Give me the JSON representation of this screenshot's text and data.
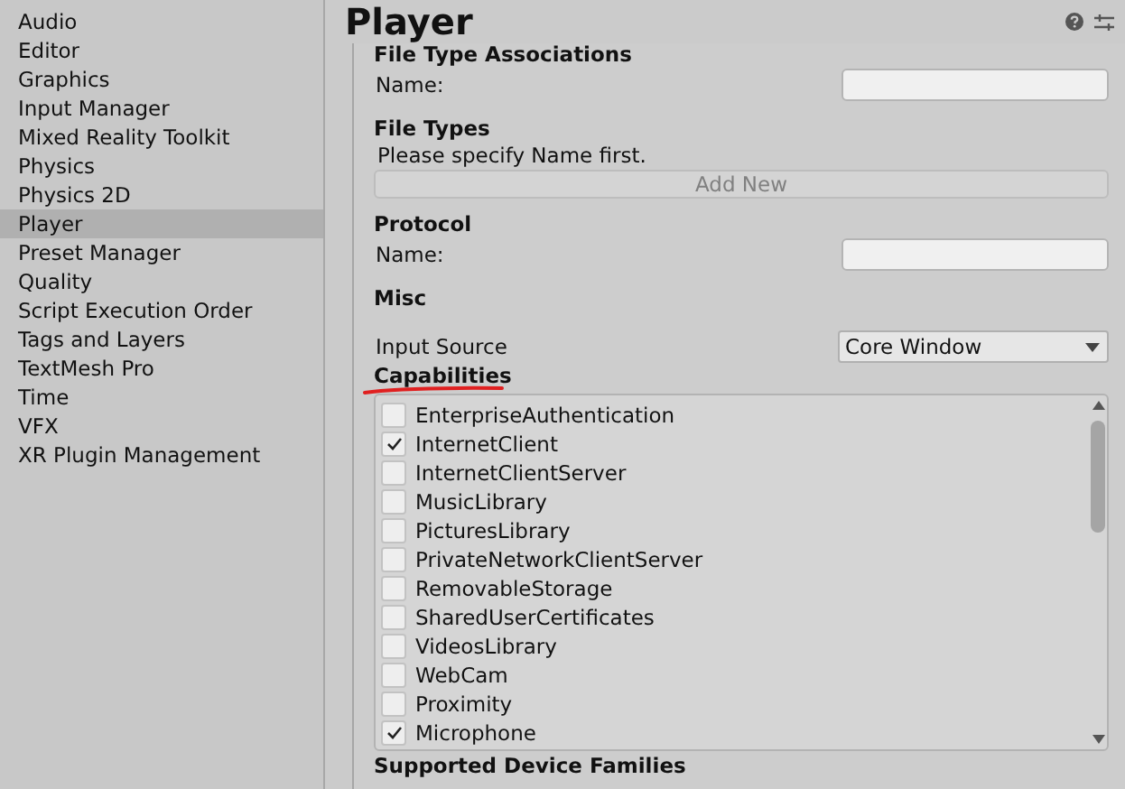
{
  "sidebar": {
    "items": [
      {
        "label": "Audio",
        "selected": false
      },
      {
        "label": "Editor",
        "selected": false
      },
      {
        "label": "Graphics",
        "selected": false
      },
      {
        "label": "Input Manager",
        "selected": false
      },
      {
        "label": "Mixed Reality Toolkit",
        "selected": false
      },
      {
        "label": "Physics",
        "selected": false
      },
      {
        "label": "Physics 2D",
        "selected": false
      },
      {
        "label": "Player",
        "selected": true
      },
      {
        "label": "Preset Manager",
        "selected": false
      },
      {
        "label": "Quality",
        "selected": false
      },
      {
        "label": "Script Execution Order",
        "selected": false
      },
      {
        "label": "Tags and Layers",
        "selected": false
      },
      {
        "label": "TextMesh Pro",
        "selected": false
      },
      {
        "label": "Time",
        "selected": false
      },
      {
        "label": "VFX",
        "selected": false
      },
      {
        "label": "XR Plugin Management",
        "selected": false
      }
    ]
  },
  "header": {
    "title": "Player"
  },
  "sections": [
    {
      "kind": "text-field",
      "heading": "File Type Associations",
      "label": "Name:"
    },
    {
      "kind": "add-list",
      "heading": "File Types",
      "message": "Please specify Name first.",
      "button": "Add New"
    },
    {
      "kind": "text-field",
      "heading": "Protocol",
      "label": "Name:"
    },
    {
      "kind": "dropdown",
      "heading": "Misc",
      "label": "Input Source",
      "value": "Core Window"
    }
  ],
  "capabilities": {
    "heading": "Capabilities",
    "items": [
      {
        "label": "EnterpriseAuthentication",
        "checked": false
      },
      {
        "label": "InternetClient",
        "checked": true
      },
      {
        "label": "InternetClientServer",
        "checked": false
      },
      {
        "label": "MusicLibrary",
        "checked": false
      },
      {
        "label": "PicturesLibrary",
        "checked": false
      },
      {
        "label": "PrivateNetworkClientServer",
        "checked": false
      },
      {
        "label": "RemovableStorage",
        "checked": false
      },
      {
        "label": "SharedUserCertificates",
        "checked": false
      },
      {
        "label": "VideosLibrary",
        "checked": false
      },
      {
        "label": "WebCam",
        "checked": false
      },
      {
        "label": "Proximity",
        "checked": false
      },
      {
        "label": "Microphone",
        "checked": true
      }
    ]
  },
  "next_section": {
    "heading": "Supported Device Families"
  }
}
